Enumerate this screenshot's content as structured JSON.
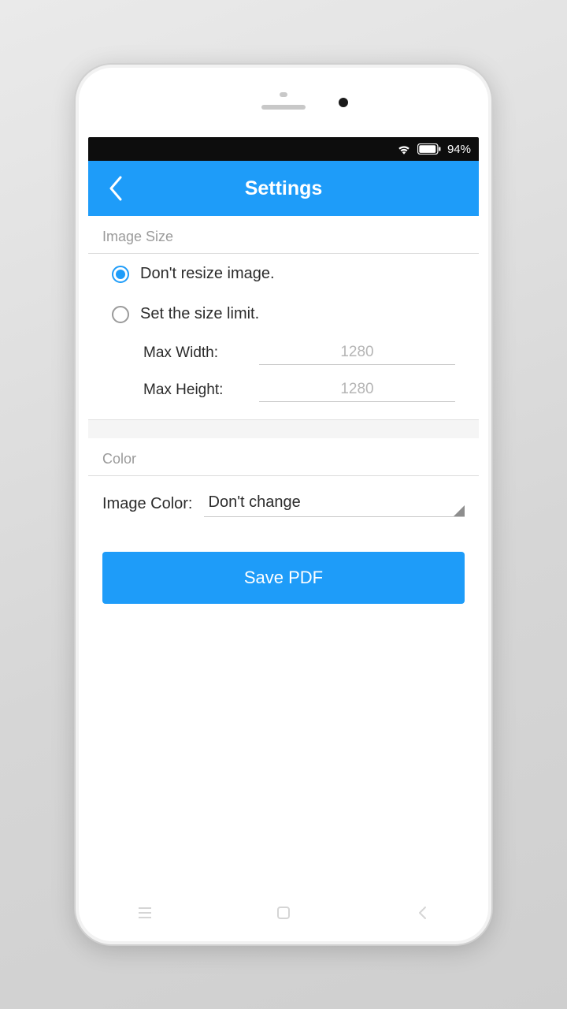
{
  "status": {
    "battery_pct": "94%"
  },
  "appbar": {
    "title": "Settings"
  },
  "sections": {
    "image_size": {
      "header": "Image Size",
      "options": {
        "dont_resize": {
          "label": "Don't resize image.",
          "selected": true
        },
        "set_limit": {
          "label": "Set the size limit.",
          "selected": false
        }
      },
      "max_width_label": "Max Width:",
      "max_width_value": "1280",
      "max_height_label": "Max Height:",
      "max_height_value": "1280"
    },
    "color": {
      "header": "Color",
      "label": "Image Color:",
      "value": "Don't change"
    }
  },
  "actions": {
    "save_label": "Save PDF"
  }
}
